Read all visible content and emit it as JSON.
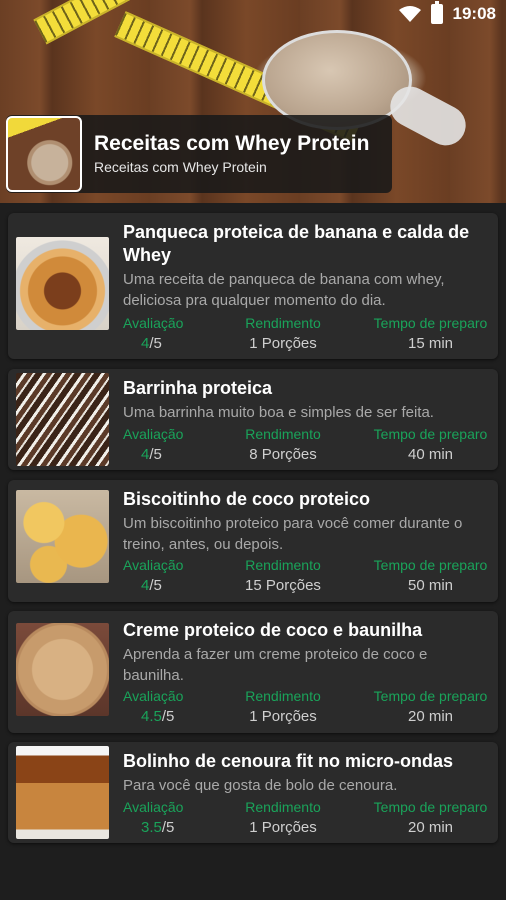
{
  "status_bar": {
    "time": "19:08"
  },
  "header": {
    "title": "Receitas com Whey Protein",
    "subtitle": "Receitas com Whey Protein"
  },
  "recipes": [
    {
      "name": "Panqueca proteica de banana e calda de Whey",
      "description": "Uma receita de panqueca de banana com whey, deliciosa pra qualquer momento do dia.",
      "rating_label": "Avaliação",
      "rating": "4",
      "rating_max": "/5",
      "yield_label": "Rendimento",
      "yield": "1 Porções",
      "time_label": "Tempo de preparo",
      "time": "15 min"
    },
    {
      "name": "Barrinha proteica",
      "description": "Uma barrinha muito boa e simples de ser feita.",
      "rating_label": "Avaliação",
      "rating": "4",
      "rating_max": "/5",
      "yield_label": "Rendimento",
      "yield": "8 Porções",
      "time_label": "Tempo de preparo",
      "time": "40 min"
    },
    {
      "name": "Biscoitinho de coco proteico",
      "description": "Um biscoitinho proteico para você comer durante o treino, antes, ou depois.",
      "rating_label": "Avaliação",
      "rating": "4",
      "rating_max": "/5",
      "yield_label": "Rendimento",
      "yield": "15 Porções",
      "time_label": "Tempo de preparo",
      "time": "50 min"
    },
    {
      "name": "Creme proteico de coco e baunilha",
      "description": "Aprenda a fazer um creme proteico de coco e baunilha.",
      "rating_label": "Avaliação",
      "rating": "4.5",
      "rating_max": "/5",
      "yield_label": "Rendimento",
      "yield": "1 Porções",
      "time_label": "Tempo de preparo",
      "time": "20 min"
    },
    {
      "name": "Bolinho de cenoura fit no micro-ondas",
      "description": "Para você que gosta de bolo de cenoura.",
      "rating_label": "Avaliação",
      "rating": "3.5",
      "rating_max": "/5",
      "yield_label": "Rendimento",
      "yield": "1 Porções",
      "time_label": "Tempo de preparo",
      "time": "20 min"
    }
  ],
  "colors": {
    "accent_green": "#1aa35a",
    "card_bg": "#2b2b2b",
    "page_bg": "#1e1e1e"
  }
}
